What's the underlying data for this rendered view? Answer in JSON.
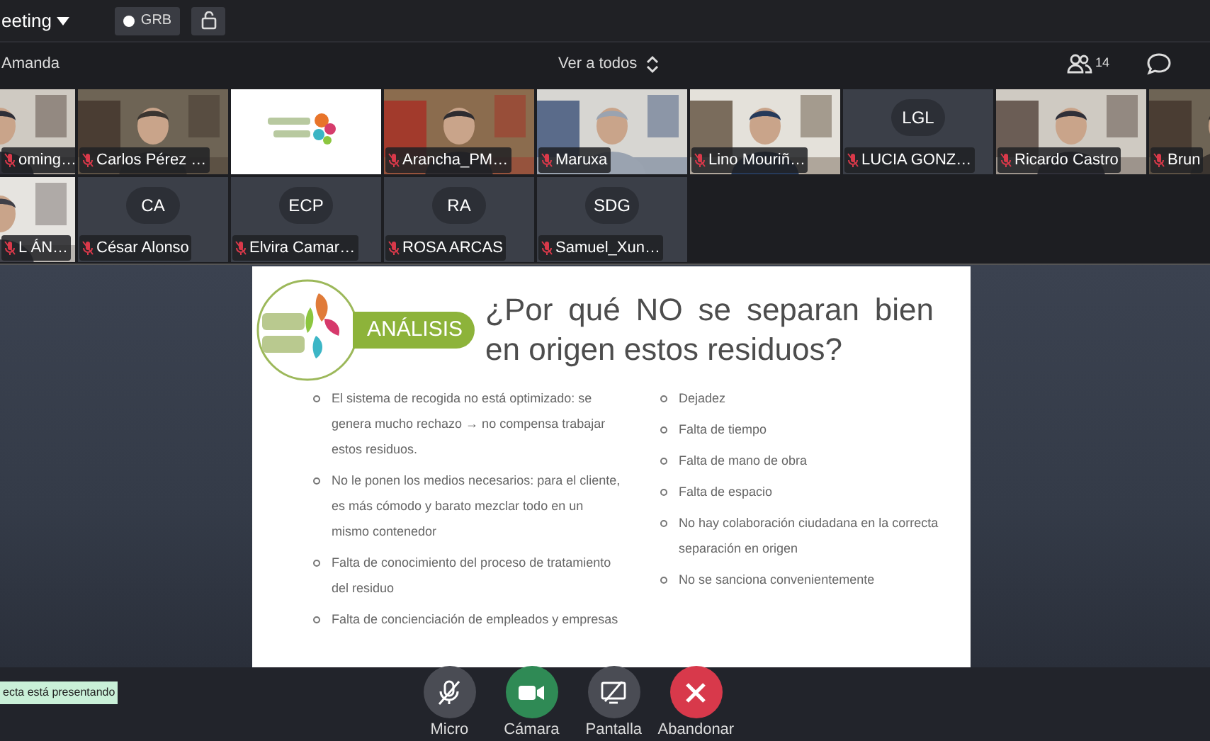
{
  "header": {
    "meeting_title": "eeting",
    "recording_badge": "GRB"
  },
  "toolbar": {
    "speaker": "Amanda",
    "view_selector": "Ver a todos",
    "participant_count": "14"
  },
  "tiles": [
    {
      "kind": "video",
      "name": "oming…"
    },
    {
      "kind": "video",
      "name": "Carlos Pérez …"
    },
    {
      "kind": "logo"
    },
    {
      "kind": "video",
      "name": "Arancha_PM…"
    },
    {
      "kind": "video",
      "name": "Maruxa"
    },
    {
      "kind": "video",
      "name": "Lino Mouriñ…"
    },
    {
      "kind": "avatar",
      "initials": "LGL",
      "name": "LUCIA GONZ…"
    },
    {
      "kind": "video",
      "name": "Ricardo Castro"
    },
    {
      "kind": "video",
      "name": "Brun"
    },
    {
      "kind": "video",
      "name": "L ÁN…"
    },
    {
      "kind": "avatar",
      "initials": "CA",
      "name": "César Alonso"
    },
    {
      "kind": "avatar",
      "initials": "ECP",
      "name": "Elvira Camar…"
    },
    {
      "kind": "avatar",
      "initials": "RA",
      "name": "ROSA ARCAS"
    },
    {
      "kind": "avatar",
      "initials": "SDG",
      "name": "Samuel_Xun…"
    }
  ],
  "slide": {
    "badge": "ANÁLISIS",
    "title": "¿Por qué NO se separan bien en origen estos residuos?",
    "left_bullets": [
      "El sistema de recogida no está optimizado: se genera mucho rechazo → no compensa trabajar estos residuos.",
      "No le ponen los medios necesarios: para el cliente, es más cómodo y barato mezclar todo en un mismo contenedor",
      "Falta de conocimiento del proceso de tratamiento del residuo",
      "Falta de concienciación de empleados y empresas"
    ],
    "right_bullets": [
      "Dejadez",
      "Falta de tiempo",
      "Falta de mano de obra",
      "Falta de espacio",
      "No hay colaboración ciudadana en la correcta separación en origen",
      "No se sanciona convenientemente"
    ]
  },
  "presenting_notice": "ecta está presentando",
  "controls": [
    {
      "kind": "mic",
      "label": "Micro",
      "on": false
    },
    {
      "kind": "camera",
      "label": "Cámara",
      "on": true
    },
    {
      "kind": "screen",
      "label": "Pantalla",
      "on": false
    },
    {
      "kind": "leave",
      "label": "Abandonar"
    }
  ]
}
